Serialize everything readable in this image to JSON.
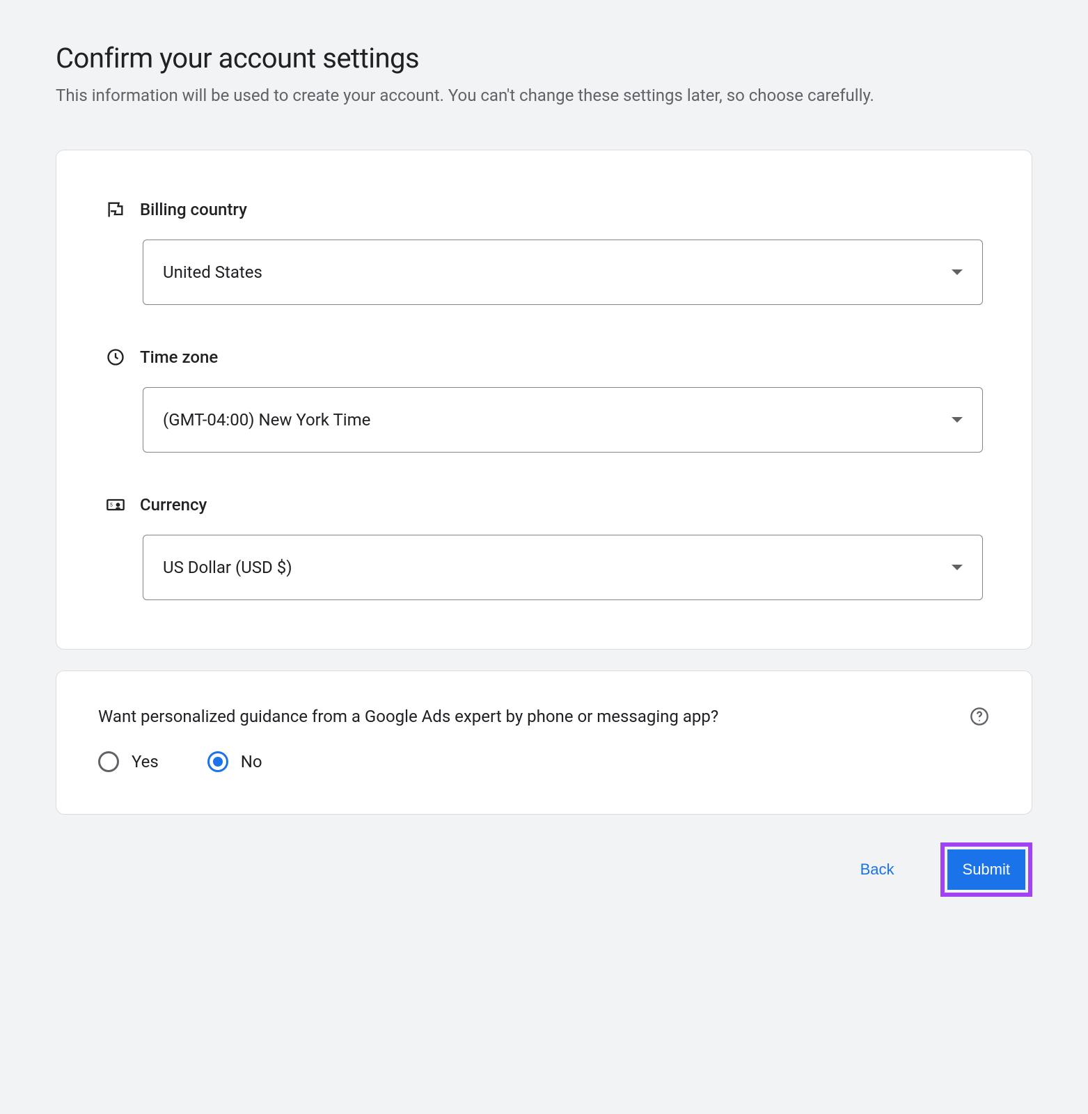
{
  "header": {
    "title": "Confirm your account settings",
    "subtitle": "This information will be used to create your account. You can't change these settings later, so choose carefully."
  },
  "fields": {
    "billing_country": {
      "label": "Billing country",
      "value": "United States"
    },
    "time_zone": {
      "label": "Time zone",
      "value": "(GMT-04:00) New York Time"
    },
    "currency": {
      "label": "Currency",
      "value": "US Dollar (USD $)"
    }
  },
  "guidance": {
    "question": "Want personalized guidance from a Google Ads expert by phone or messaging app?",
    "options": {
      "yes": "Yes",
      "no": "No"
    },
    "selected": "no"
  },
  "buttons": {
    "back": "Back",
    "submit": "Submit"
  }
}
